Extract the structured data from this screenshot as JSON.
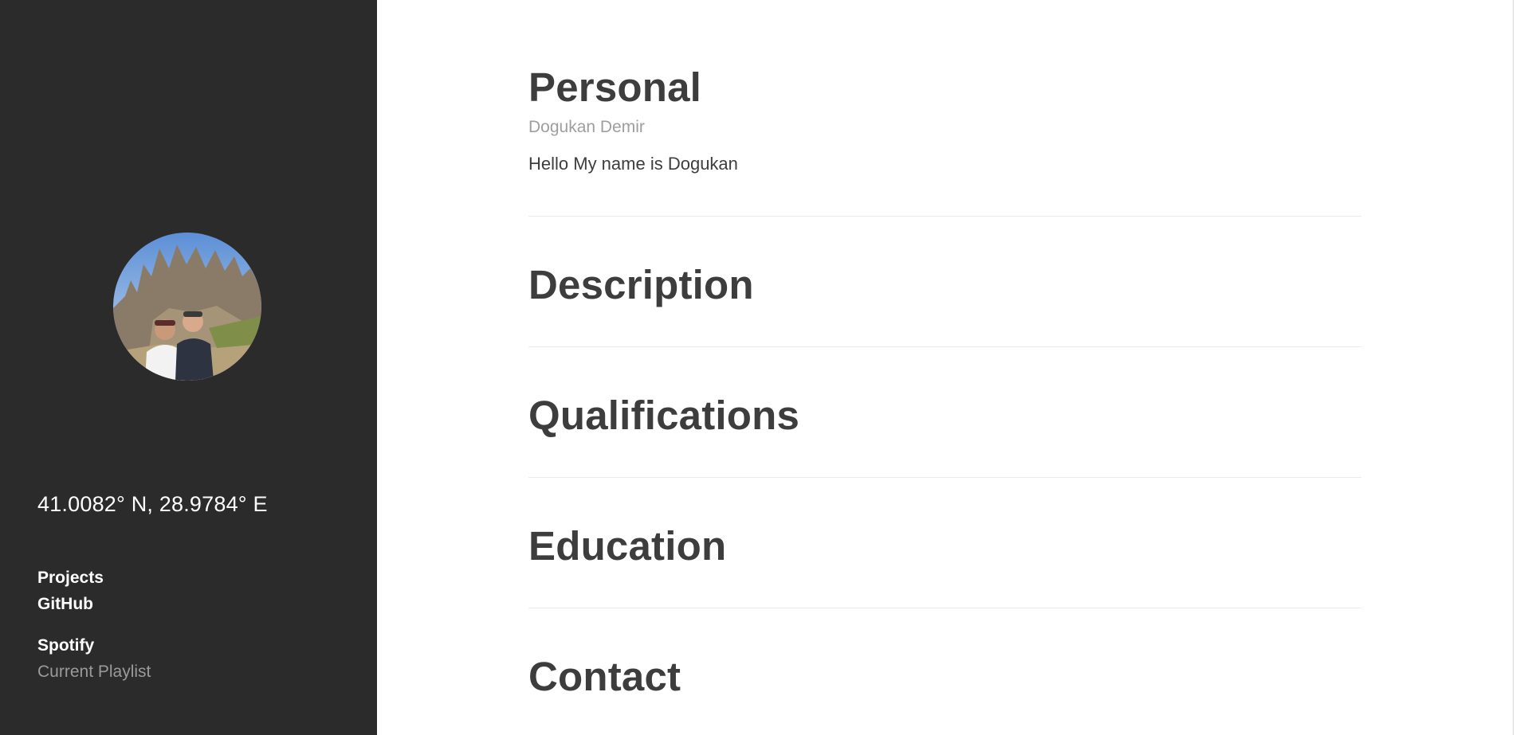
{
  "sidebar": {
    "coordinates": "41.0082° N, 28.9784° E",
    "links": {
      "projects": "Projects",
      "github": "GitHub",
      "spotify": "Spotify",
      "playlist": "Current Playlist"
    }
  },
  "main": {
    "personal": {
      "title": "Personal",
      "name": "Dogukan Demir",
      "intro": "Hello My name is Dogukan"
    },
    "description": {
      "title": "Description"
    },
    "qualifications": {
      "title": "Qualifications"
    },
    "education": {
      "title": "Education"
    },
    "contact": {
      "title": "Contact"
    }
  },
  "colors": {
    "sidebar_bg": "#2b2b2b",
    "heading": "#3d3d3d",
    "muted": "#9e9e9e",
    "divider": "#eaeaea"
  },
  "icons": {
    "avatar": "profile-photo"
  }
}
